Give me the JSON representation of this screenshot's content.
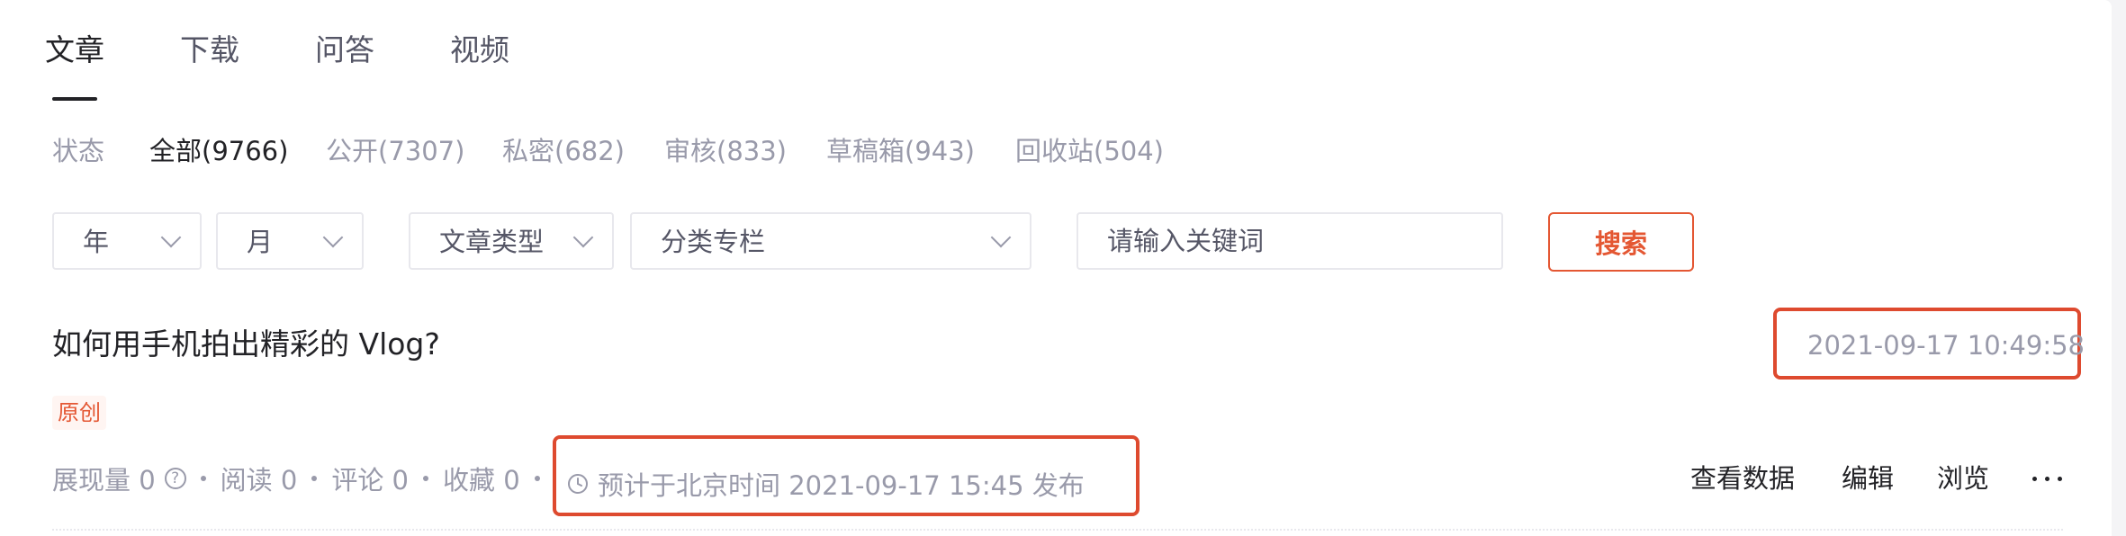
{
  "tabs": [
    {
      "label": "文章",
      "active": true
    },
    {
      "label": "下载",
      "active": false
    },
    {
      "label": "问答",
      "active": false
    },
    {
      "label": "视频",
      "active": false
    }
  ],
  "status_filter": {
    "label": "状态",
    "items": [
      {
        "label": "全部(9766)",
        "active": true
      },
      {
        "label": "公开(7307)",
        "active": false
      },
      {
        "label": "私密(682)",
        "active": false
      },
      {
        "label": "审核(833)",
        "active": false
      },
      {
        "label": "草稿箱(943)",
        "active": false
      },
      {
        "label": "回收站(504)",
        "active": false
      }
    ]
  },
  "filters": {
    "year": "年",
    "month": "月",
    "article_type": "文章类型",
    "category": "分类专栏",
    "keyword_placeholder": "请输入关键词",
    "search_label": "搜索"
  },
  "article": {
    "title": "如何用手机拍出精彩的 Vlog?",
    "datetime": "2021-09-17 10:49:58",
    "badge": "原创",
    "stats": {
      "impressions": "展现量 0",
      "reads": "阅读 0",
      "comments": "评论 0",
      "favorites": "收藏 0"
    },
    "scheduled": "预计于北京时间 2021-09-17 15:45 发布",
    "actions": {
      "view_data": "查看数据",
      "edit": "编辑",
      "browse": "浏览"
    }
  },
  "colors": {
    "accent": "#e45733",
    "highlight": "#de4a2f",
    "text_primary": "#222226",
    "text_secondary": "#555666",
    "text_muted": "#999aaa",
    "border": "#e8e8ed"
  },
  "icons": {
    "help": "question-circle-icon",
    "clock": "clock-icon",
    "more": "more-horizontal-icon",
    "dropdown": "chevron-down-icon"
  }
}
